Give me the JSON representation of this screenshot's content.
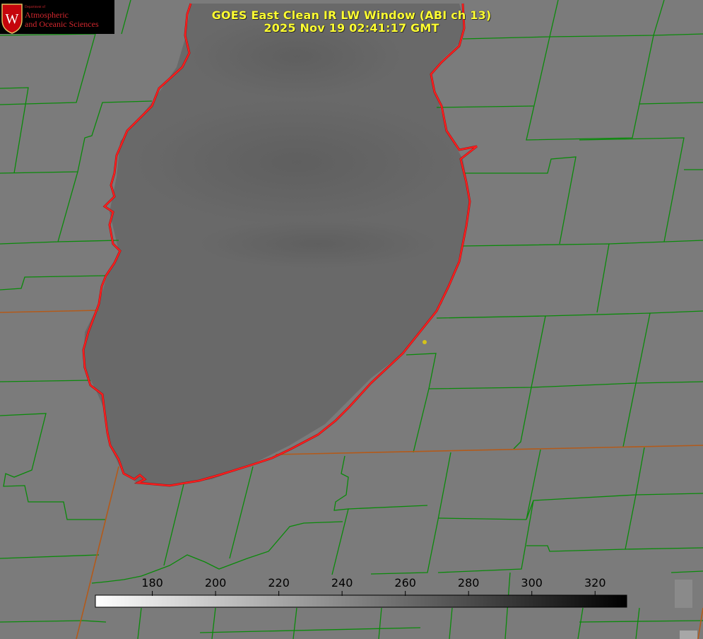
{
  "title": {
    "line1": "GOES East Clean IR LW Window (ABI ch 13)",
    "line2": "2025 Nov 19 02:41:17 GMT"
  },
  "logo": {
    "department": "Department of",
    "line1": "Atmospheric",
    "line2": "and Oceanic Sciences",
    "emblem_letter": "W"
  },
  "colorbar": {
    "min": 162,
    "max": 330,
    "ticks": [
      "180",
      "200",
      "220",
      "240",
      "260",
      "280",
      "300",
      "320"
    ],
    "ramp": "white-to-black"
  },
  "colors": {
    "county_lines": "#0a8a0a",
    "coastline": "#ff2020",
    "state_lines": "#b35a1a",
    "title": "#ffff33",
    "marker": "#d4c21a",
    "background": "#7b7b7b"
  }
}
